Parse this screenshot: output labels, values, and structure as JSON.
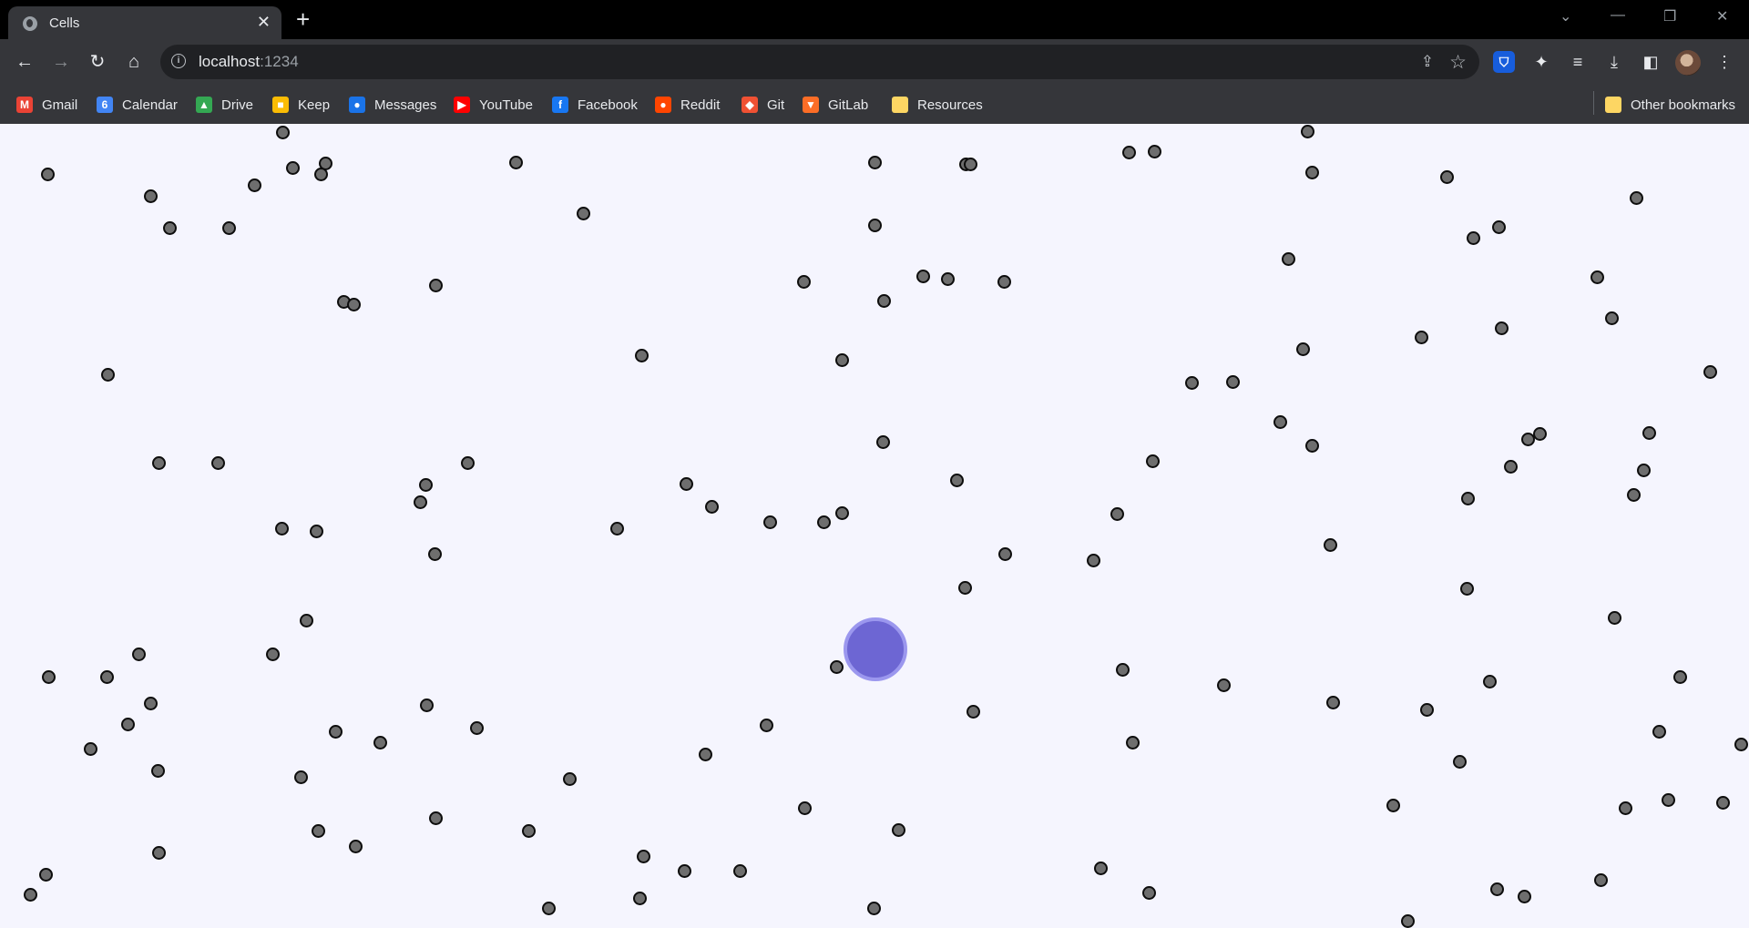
{
  "browser": {
    "tab_title": "Cells",
    "tab_close": "✕",
    "new_tab": "+",
    "url_host": "localhost",
    "url_port": ":1234",
    "bookmarks": [
      {
        "label": "Gmail",
        "icon": "gmail-icon",
        "color": "#ea4335",
        "glyph": "M"
      },
      {
        "label": "Calendar",
        "icon": "calendar-icon",
        "color": "#4285f4",
        "glyph": "6"
      },
      {
        "label": "Drive",
        "icon": "drive-icon",
        "color": "#34a853",
        "glyph": "▲"
      },
      {
        "label": "Keep",
        "icon": "keep-icon",
        "color": "#fbbc04",
        "glyph": "■"
      },
      {
        "label": "Messages",
        "icon": "messages-icon",
        "color": "#1a73e8",
        "glyph": "●"
      },
      {
        "label": "YouTube",
        "icon": "youtube-icon",
        "color": "#ff0000",
        "glyph": "▶"
      },
      {
        "label": "Facebook",
        "icon": "facebook-icon",
        "color": "#1877f2",
        "glyph": "f"
      },
      {
        "label": "Reddit",
        "icon": "reddit-icon",
        "color": "#ff4500",
        "glyph": "●"
      },
      {
        "label": "Git",
        "icon": "git-icon",
        "color": "#f05133",
        "glyph": "◆"
      },
      {
        "label": "GitLab",
        "icon": "gitlab-icon",
        "color": "#fc6d26",
        "glyph": "▼"
      },
      {
        "label": "Resources",
        "icon": "folder-icon",
        "color": "#fdd663",
        "glyph": ""
      }
    ],
    "other_bookmarks": "Other bookmarks"
  },
  "game": {
    "cell_color": "#6e6e6e",
    "cell_border": "#0d0d0d",
    "player_color": "#6d66d3",
    "player_border": "#9b97ee",
    "background": "#f5f5fe"
  }
}
